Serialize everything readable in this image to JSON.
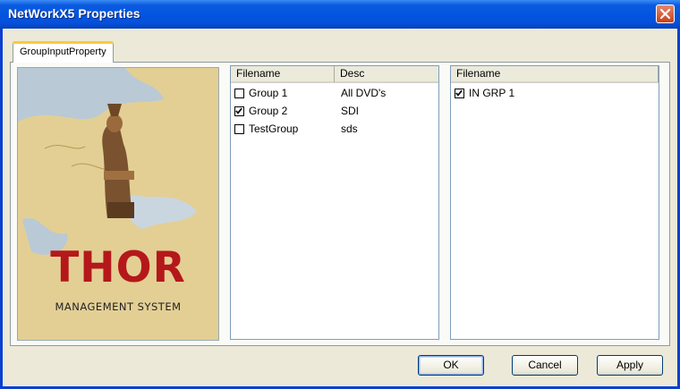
{
  "window": {
    "title": "NetWorkX5 Properties"
  },
  "tabs": [
    {
      "label": "GroupInputProperty"
    }
  ],
  "logo": {
    "brand": "THOR",
    "tagline": "MANAGEMENT SYSTEM"
  },
  "groups_list": {
    "columns": [
      "Filename",
      "Desc"
    ],
    "rows": [
      {
        "name": "Group 1",
        "desc": "All DVD's",
        "checked": false
      },
      {
        "name": "Group 2",
        "desc": "SDI",
        "checked": true
      },
      {
        "name": "TestGroup",
        "desc": "sds",
        "checked": false
      }
    ]
  },
  "inputs_list": {
    "columns": [
      "Filename"
    ],
    "rows": [
      {
        "name": "IN GRP 1",
        "checked": true
      }
    ]
  },
  "buttons": {
    "ok": "OK",
    "cancel": "Cancel",
    "apply": "Apply"
  },
  "colors": {
    "titlebar": "#0454e0",
    "close": "#c9401d",
    "brand_red": "#b5181a",
    "dialog_bg": "#ece9d8"
  }
}
